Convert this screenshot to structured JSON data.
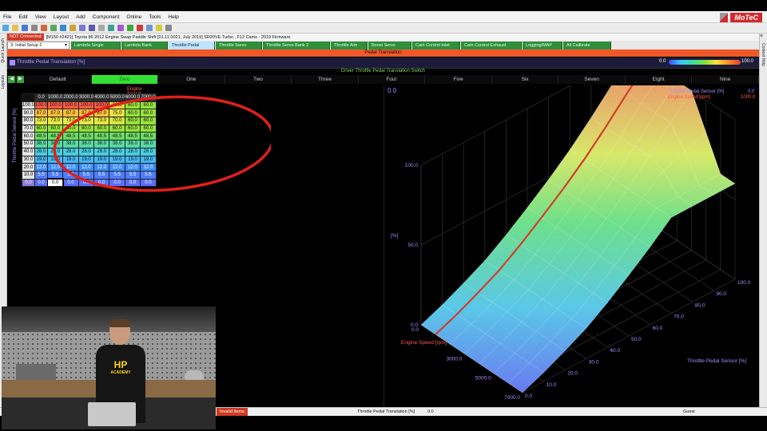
{
  "app": {
    "logo_text": "MoTeC"
  },
  "menu": [
    "File",
    "Edit",
    "View",
    "Layout",
    "Add",
    "Component",
    "Online",
    "Tools",
    "Help"
  ],
  "status": {
    "connection": "NOT Connected",
    "project": "[M150 #2421] Toyota 86 2012 Engine Swap Paddle Shift [01.11.0021, July 2019] SR20VE Turbo , F12 Cams - 2019 Firmware"
  },
  "setup_select": "3: Initial Setup 2",
  "tabs": [
    "Lambda Single",
    "Lambda Bank",
    "Throttle Pedal",
    "Throttle Servo",
    "Throttle Servo Bank 2",
    "Throttle Aim",
    "Boost Servo",
    "Cam Control Inlet",
    "Cam Control Exhaust",
    "Logging/MAP",
    "All Calibrate"
  ],
  "active_tab": "Throttle Pedal",
  "left_strip": [
    "Quick Launch",
    "Layouts"
  ],
  "right_strip": [
    "Context Help"
  ],
  "page_header": "Pedal Translation",
  "table_title": "Throttle Pedal Translation [%]",
  "scale": {
    "min": "0.0",
    "max": "100.0"
  },
  "switch": {
    "label": "Driver Throttle Pedal Translation Switch",
    "options": [
      "Default",
      "Zero",
      "One",
      "Two",
      "Three",
      "Four",
      "Five",
      "Six",
      "Seven",
      "Eight",
      "Nine"
    ],
    "active": "Zero"
  },
  "table": {
    "x_axis_label": "Engine Speed [rpm]",
    "y_axis_label": "Throttle Pedal Sensor [%]",
    "columns": [
      "0.0",
      "1000.0",
      "2000.0",
      "3000.0",
      "4000.0",
      "5000.0",
      "6000.0",
      "7000.0"
    ],
    "rows": [
      {
        "y": "100.0",
        "cells": [
          "100.0",
          "100.0",
          "100.0",
          "100.0",
          "100.0",
          "80.0",
          "60.0",
          "60.0"
        ]
      },
      {
        "y": "90.0",
        "cells": [
          "87.0",
          "87.0",
          "87.0",
          "87.0",
          "87.0",
          "75.0",
          "60.0",
          "60.0"
        ]
      },
      {
        "y": "80.0",
        "cells": [
          "73.0",
          "73.0",
          "73.0",
          "73.0",
          "73.0",
          "70.0",
          "60.0",
          "60.0"
        ]
      },
      {
        "y": "70.0",
        "cells": [
          "60.0",
          "60.0",
          "60.0",
          "60.0",
          "60.0",
          "60.0",
          "60.0",
          "60.0"
        ]
      },
      {
        "y": "60.0",
        "cells": [
          "48.5",
          "48.5",
          "48.5",
          "48.5",
          "48.5",
          "48.5",
          "48.5",
          "48.5"
        ]
      },
      {
        "y": "50.0",
        "cells": [
          "38.0",
          "38.0",
          "38.0",
          "38.0",
          "38.0",
          "38.0",
          "38.0",
          "38.0"
        ]
      },
      {
        "y": "40.0",
        "cells": [
          "28.0",
          "28.0",
          "28.0",
          "28.0",
          "28.0",
          "28.0",
          "28.0",
          "28.0"
        ]
      },
      {
        "y": "30.0",
        "cells": [
          "19.0",
          "19.0",
          "19.0",
          "19.0",
          "19.0",
          "19.0",
          "19.0",
          "19.0"
        ]
      },
      {
        "y": "20.0",
        "cells": [
          "12.0",
          "12.0",
          "12.0",
          "12.0",
          "12.0",
          "12.0",
          "12.0",
          "12.0"
        ]
      },
      {
        "y": "10.0",
        "cells": [
          "5.5",
          "5.5",
          "5.5",
          "5.5",
          "5.5",
          "5.5",
          "5.5",
          "5.5"
        ]
      },
      {
        "y": "0.0",
        "cells": [
          "0.0",
          "0.0",
          "0.0",
          "0.0",
          "0.0",
          "0.0",
          "0.0",
          "0.0"
        ]
      }
    ],
    "selected_row": "0.0"
  },
  "graph": {
    "cursor_value": "0.0",
    "legend": [
      {
        "name": "Throttle Pedal Sensor [%]",
        "value": "0.0",
        "color": "#a78cff"
      },
      {
        "name": "Engine Speed [rpm]",
        "value": "1000.0",
        "color": "#ff5a4a"
      }
    ],
    "z_label": "[%]",
    "z_ticks": [
      "100.0",
      "50.0",
      "0.0"
    ],
    "x_label": "Engine Speed [rpm]",
    "x_ticks": [
      "0.0",
      "3000.0",
      "5000.0",
      "7000.0"
    ],
    "y_label": "Throttle Pedal Sensor [%]",
    "y_ticks": [
      "0.0",
      "10.0",
      "20.0",
      "30.0",
      "40.0",
      "50.0",
      "60.0",
      "70.0",
      "80.0",
      "90.0",
      "100.0"
    ]
  },
  "bottom": {
    "invalid": "Invalid Items",
    "channel": "Throttle Pedal Translation [%]",
    "value": "0.0",
    "user": "Guest"
  },
  "webcam": {
    "shirt_text": "HP",
    "shirt_subtext": "ACADEMY"
  },
  "colors": {
    "accent": "#f0582a",
    "tab_green": "#2f8f3a",
    "annotation": "#e0201a"
  }
}
